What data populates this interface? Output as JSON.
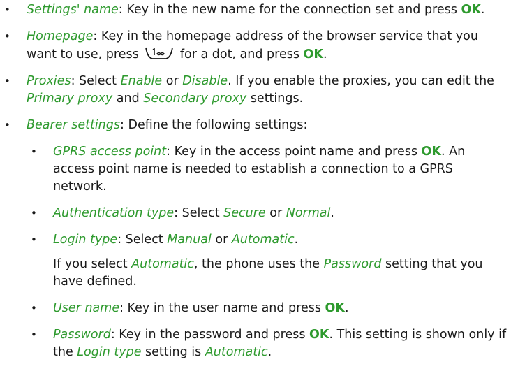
{
  "items": [
    {
      "term": "Settings' name",
      "t1": ": Key in the new name for the connection set and press ",
      "kw": "OK",
      "t2": "."
    },
    {
      "term": "Homepage",
      "t1": ": Key in the homepage address of the browser service that you want to use, press ",
      "key_icon": "key-1-icon",
      "t2": " for a dot, and press ",
      "kw": "OK",
      "t3": "."
    },
    {
      "term": "Proxies",
      "t1": ": Select ",
      "opt1": "Enable",
      "t2": " or ",
      "opt2": "Disable",
      "t3": ". If you enable the proxies, you can edit the ",
      "opt3": "Primary proxy",
      "t4": " and ",
      "opt4": "Secondary proxy",
      "t5": " settings."
    },
    {
      "term": "Bearer settings",
      "t1": ": Define the following settings:",
      "sub": [
        {
          "term": "GPRS access point",
          "t1": ": Key in the access point name and press ",
          "kw": "OK",
          "t2": ". An access point name is needed to establish a connection to a GPRS network."
        },
        {
          "term": "Authentication type",
          "t1": ": Select ",
          "opt1": "Secure",
          "t2": " or ",
          "opt2": "Normal",
          "t3": "."
        },
        {
          "term": "Login type",
          "t1": ": Select ",
          "opt1": "Manual",
          "t2": " or ",
          "opt2": "Automatic",
          "t3": ".",
          "note": {
            "t1": "If you select ",
            "opt1": "Automatic",
            "t2": ", the phone uses the ",
            "opt2": "Password",
            "t3": " setting that you have defined."
          }
        },
        {
          "term": "User name",
          "t1": ": Key in the user name and press ",
          "kw": "OK",
          "t2": "."
        },
        {
          "term": "Password",
          "t1": ": Key in the password and press ",
          "kw": "OK",
          "t2": ". This setting is shown only if the ",
          "opt1": "Login type",
          "t3": " setting is ",
          "opt2": "Automatic",
          "t4": "."
        }
      ]
    }
  ],
  "bullet_glyph": "•",
  "colors": {
    "accent_green": "#2e9a2e",
    "text": "#1a1a1a"
  }
}
